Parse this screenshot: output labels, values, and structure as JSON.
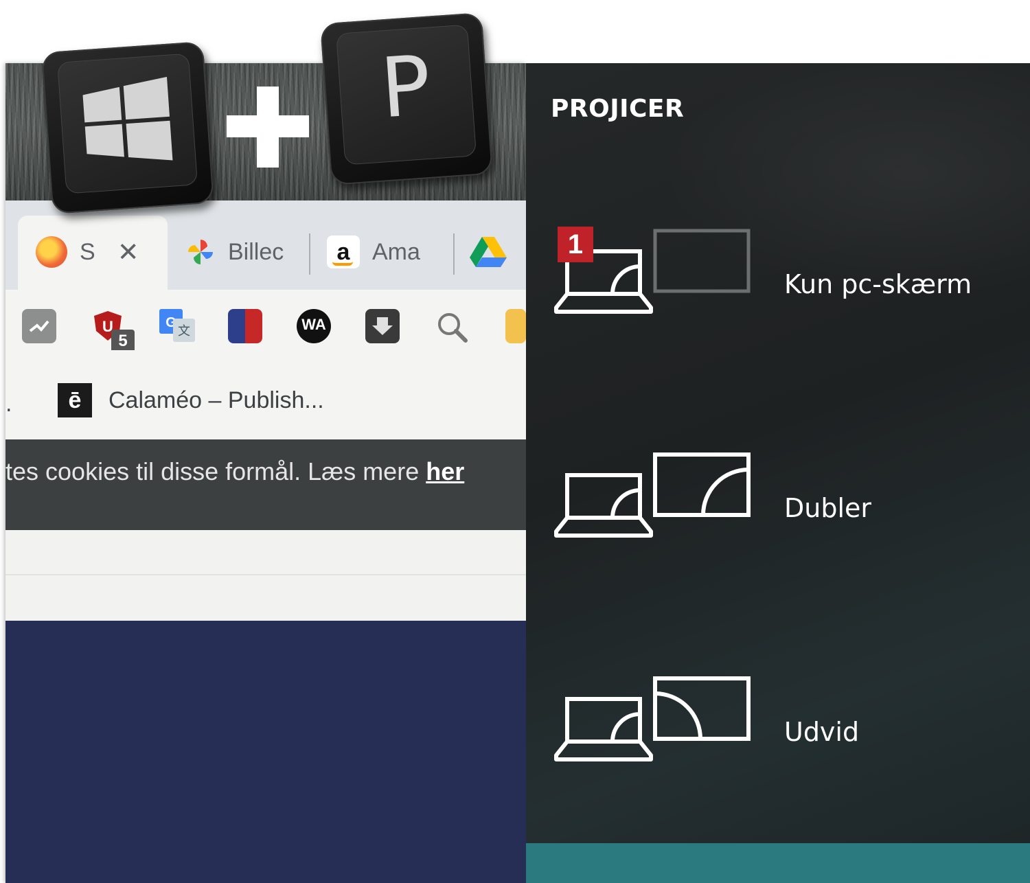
{
  "browser": {
    "tabs": [
      {
        "label": "S",
        "icon": "orange-site-favicon",
        "close": "✕"
      },
      {
        "label": "Billec",
        "icon": "google-photos-icon"
      },
      {
        "label": "Ama",
        "icon": "amazon-icon",
        "glyph": "a"
      },
      {
        "label": "",
        "icon": "google-drive-icon"
      }
    ],
    "extensions": [
      {
        "name": "analytics-extension-icon"
      },
      {
        "name": "ublock-extension-icon",
        "badge": "5"
      },
      {
        "name": "translate-extension-icon"
      },
      {
        "name": "red-blue-extension-icon"
      },
      {
        "name": "wa-extension-icon",
        "text": "WA"
      },
      {
        "name": "download-extension-icon"
      },
      {
        "name": "search-extension-icon"
      }
    ],
    "bookmark": {
      "icon_letter": "ē",
      "label": "Calaméo – Publish..."
    },
    "cookie_text": "tes cookies til disse formål. Læs mere ",
    "cookie_link": "her"
  },
  "keys": {
    "win_icon": "windows-logo-icon",
    "plus": "+",
    "letter": "P"
  },
  "panel": {
    "title": "PROJICER",
    "options": [
      {
        "label": "Kun pc-skærm",
        "badge": "1"
      },
      {
        "label": "Dubler"
      },
      {
        "label": "Udvid"
      }
    ]
  },
  "colors": {
    "panel_bg": "#1e2122",
    "footer_accent": "#2a7a80",
    "badge_red": "#c0222a",
    "page_dark_blue": "#262e55"
  }
}
